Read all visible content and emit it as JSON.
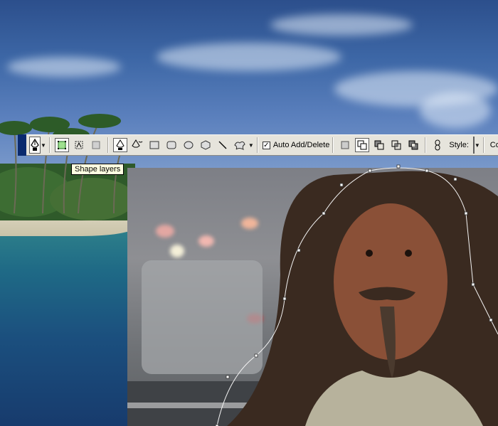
{
  "canvas": {
    "background_image": "tropical-beach-scene",
    "overlay_image": "long-haired-man-street-portrait"
  },
  "toolbar": {
    "tool_preset": "pen-tool-icon",
    "modes": [
      {
        "name": "shape-layers",
        "icon": "shape-layers-icon",
        "active": true
      },
      {
        "name": "paths",
        "icon": "paths-icon",
        "active": false
      },
      {
        "name": "fill-pixels",
        "icon": "fill-pixels-icon",
        "active": false
      }
    ],
    "tools": [
      {
        "name": "pen",
        "icon": "pen-tool-icon",
        "active": true
      },
      {
        "name": "freeform-pen",
        "icon": "freeform-pen-icon",
        "active": false
      },
      {
        "name": "rectangle",
        "icon": "rectangle-icon",
        "active": false
      },
      {
        "name": "rounded-rectangle",
        "icon": "rounded-rectangle-icon",
        "active": false
      },
      {
        "name": "ellipse",
        "icon": "ellipse-icon",
        "active": false
      },
      {
        "name": "polygon",
        "icon": "polygon-icon",
        "active": false
      },
      {
        "name": "line",
        "icon": "line-icon",
        "active": false
      },
      {
        "name": "custom-shape",
        "icon": "custom-shape-icon",
        "active": false
      }
    ],
    "auto_add_delete": {
      "label": "Auto Add/Delete",
      "checked": true
    },
    "path_ops": [
      "add-to-shape-area-icon",
      "subtract-icon",
      "intersect-icon",
      "exclude-icon",
      "combine-icon"
    ],
    "style_label": "Style:",
    "color_label": "Color:",
    "color_value": "#f1ebb0",
    "accent": "#0a2a6e"
  },
  "tooltip": {
    "text": "Shape layers"
  }
}
